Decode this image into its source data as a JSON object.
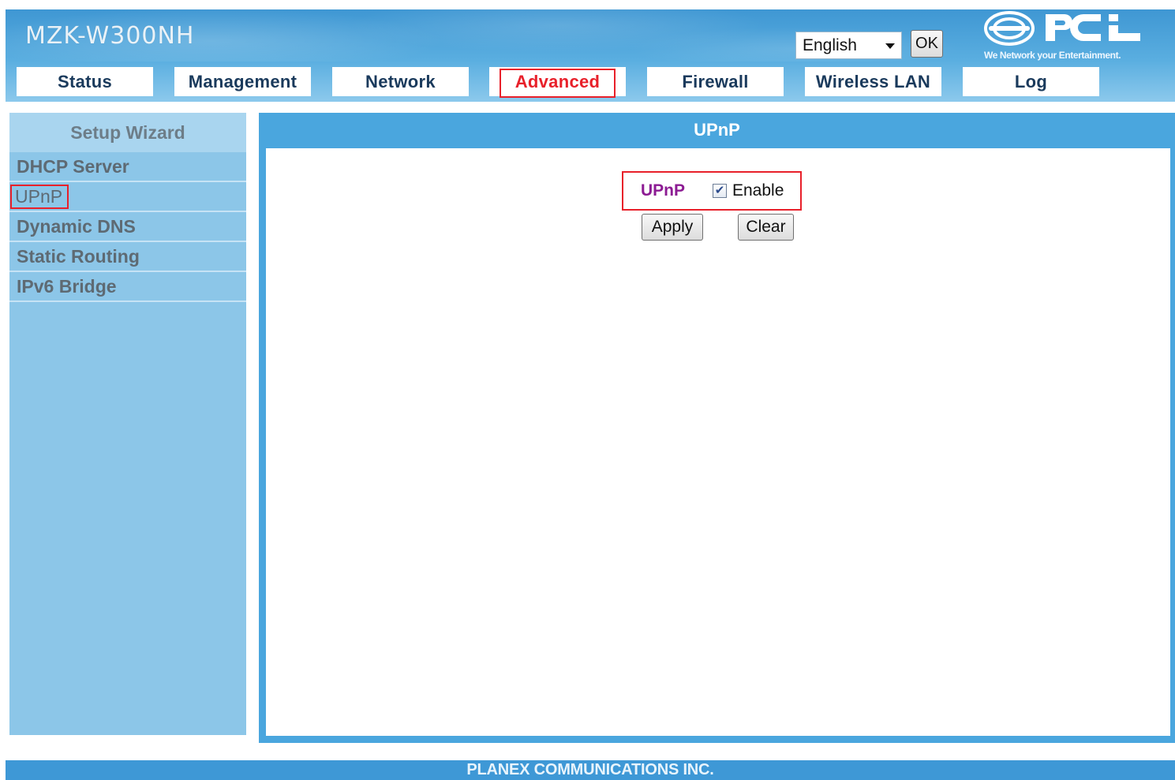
{
  "header": {
    "model": "MZK-W300NH",
    "language": {
      "selected": "English",
      "ok_label": "OK"
    },
    "logo": {
      "brand": "PCi",
      "tagline": "We Network your Entertainment."
    }
  },
  "tabs": [
    {
      "label": "Status",
      "active": false
    },
    {
      "label": "Management",
      "active": false
    },
    {
      "label": "Network",
      "active": false
    },
    {
      "label": "Advanced",
      "active": true
    },
    {
      "label": "Firewall",
      "active": false
    },
    {
      "label": "Wireless LAN",
      "active": false
    },
    {
      "label": "Log",
      "active": false
    }
  ],
  "sidebar": {
    "heading": "Setup Wizard",
    "items": [
      {
        "label": "DHCP Server",
        "active": false
      },
      {
        "label": "UPnP",
        "active": true
      },
      {
        "label": "Dynamic DNS",
        "active": false
      },
      {
        "label": "Static Routing",
        "active": false
      },
      {
        "label": "IPv6 Bridge",
        "active": false
      }
    ]
  },
  "main": {
    "title": "UPnP",
    "upnp": {
      "label": "UPnP",
      "enable_label": "Enable",
      "enabled": true
    },
    "apply_label": "Apply",
    "clear_label": "Clear"
  },
  "footer": {
    "text": "PLANEX COMMUNICATIONS INC."
  },
  "colors": {
    "header_blue": "#4aa6de",
    "sidebar_blue": "#8cc6e8",
    "highlight_red": "#e8202a",
    "upnp_label_purple": "#8c1b93"
  }
}
